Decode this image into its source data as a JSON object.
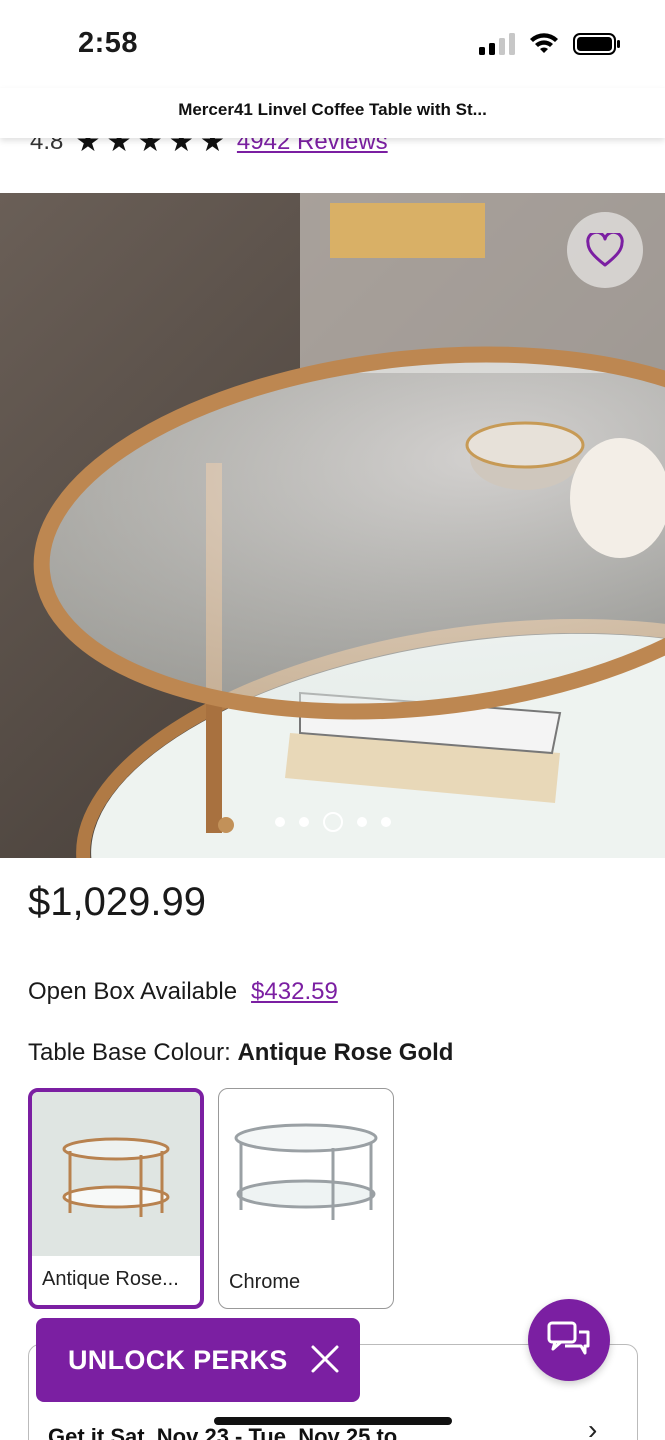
{
  "status_bar": {
    "time": "2:58"
  },
  "header": {
    "title": "Mercer41 Linvel Coffee Table with St..."
  },
  "rating": {
    "value": "4.8",
    "stars": 5,
    "reviews_label": "4942 Reviews"
  },
  "gallery": {
    "image_count": 5,
    "active_index": 2
  },
  "price": "$1,029.99",
  "open_box": {
    "label": "Open Box Available",
    "price": "$432.59"
  },
  "colour": {
    "label": "Table Base Colour:",
    "selected": "Antique Rose Gold"
  },
  "swatches": [
    {
      "label": "Antique Rose...",
      "selected": true
    },
    {
      "label": "Chrome",
      "selected": false
    }
  ],
  "delivery": {
    "text": "Get it Sat, Nov 23 - Tue, Nov 25 to"
  },
  "perks_banner": {
    "label": "UNLOCK PERKS"
  },
  "colors": {
    "accent": "#7b1fa2"
  },
  "icons": [
    "heart-icon",
    "close-icon",
    "chat-icon",
    "chevron-right-icon",
    "wifi-icon",
    "battery-icon",
    "signal-icon",
    "star-icon"
  ]
}
